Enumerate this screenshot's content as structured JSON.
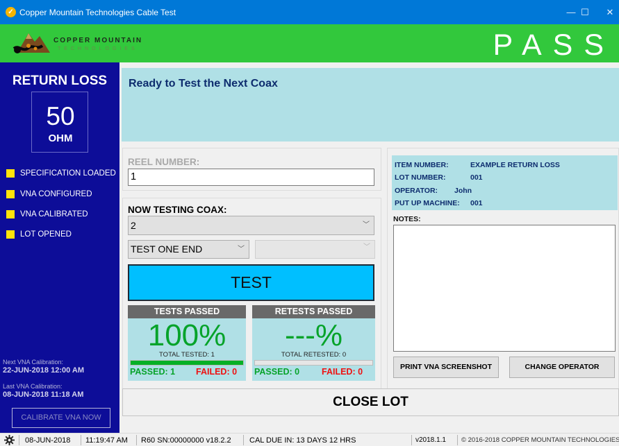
{
  "window": {
    "title": "Copper Mountain Technologies Cable Test",
    "controls": {
      "minimize": "—",
      "maximize": "☐",
      "close": "✕"
    }
  },
  "header": {
    "logo_line1": "COPPER MOUNTAIN",
    "logo_line2": "TECHNOLOGIES",
    "result": "PASS",
    "result_color": "#32c83c"
  },
  "sidebar": {
    "title": "RETURN LOSS",
    "impedance_value": "50",
    "impedance_unit": "OHM",
    "status_items": [
      "SPECIFICATION LOADED",
      "VNA CONFIGURED",
      "VNA CALIBRATED",
      "LOT OPENED"
    ],
    "next_cal_label": "Next VNA Calibration:",
    "next_cal_value": "22-JUN-2018 12:00 AM",
    "last_cal_label": "Last VNA Calibration:",
    "last_cal_value": "08-JUN-2018 11:18 AM",
    "calibrate_button": "CALIBRATE VNA NOW"
  },
  "message": "Ready to Test the Next Coax",
  "reel": {
    "label": "REEL NUMBER:",
    "value": "1"
  },
  "testing": {
    "label": "NOW TESTING COAX:",
    "coax_value": "2",
    "end_value": "TEST ONE END",
    "end2_value": "",
    "test_button": "TEST"
  },
  "tests_passed": {
    "header": "TESTS PASSED",
    "percent": "100%",
    "total": "TOTAL TESTED: 1",
    "progress": 1.0,
    "passed": "PASSED: 1",
    "failed": "FAILED: 0"
  },
  "retests_passed": {
    "header": "RETESTS PASSED",
    "percent": "---%",
    "total": "TOTAL RETESTED: 0",
    "progress": 0.0,
    "passed": "PASSED: 0",
    "failed": "FAILED: 0"
  },
  "info": {
    "item_number_label": "ITEM NUMBER:",
    "item_number": "EXAMPLE RETURN LOSS",
    "lot_number_label": "LOT NUMBER:",
    "lot_number": "001",
    "operator_label": "OPERATOR:",
    "operator": "John",
    "putup_label": "PUT UP MACHINE:",
    "putup": "001"
  },
  "notes_label": "NOTES:",
  "notes_value": "",
  "buttons": {
    "print": "PRINT VNA SCREENSHOT",
    "change_operator": "CHANGE OPERATOR",
    "close_lot": "CLOSE LOT"
  },
  "statusbar": {
    "date": "08-JUN-2018",
    "time": "11:19:47 AM",
    "device": "R60  SN:00000000  v18.2.2",
    "cal_due": "CAL DUE IN: 13 DAYS 12 HRS",
    "version": "v2018.1.1",
    "copyright": "© 2016-2018 COPPER MOUNTAIN TECHNOLOGIES"
  }
}
